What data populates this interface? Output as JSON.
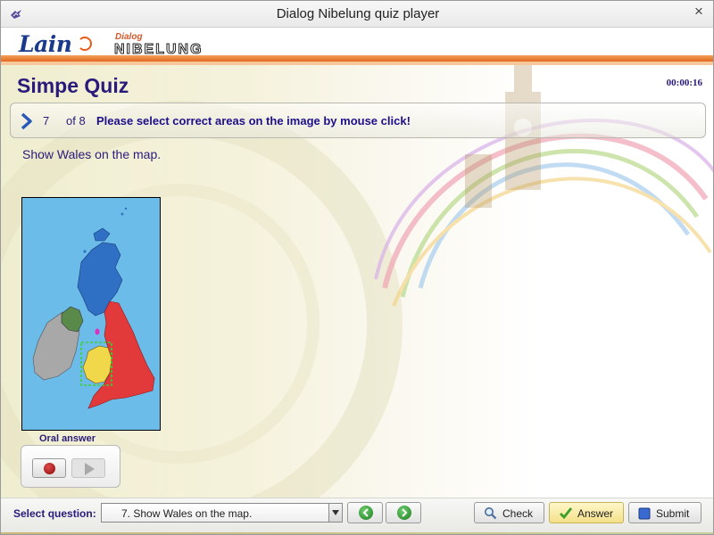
{
  "window": {
    "title": "Dialog Nibelung quiz player",
    "close_glyph": "×"
  },
  "header": {
    "logo_lain": "Lain",
    "logo_dialog": "Dialog",
    "logo_nibelung": "NIBELUNG"
  },
  "quiz": {
    "title": "Simpe Quiz",
    "timer": "00:00:16"
  },
  "question_bar": {
    "number": "7",
    "of_total": "of 8",
    "instruction": "Please select correct areas on the image by mouse click!"
  },
  "question": {
    "text": "Show Wales on the map."
  },
  "oral": {
    "label": "Oral answer"
  },
  "bottom": {
    "select_label": "Select question:",
    "select_value": "7. Show Wales on the map.",
    "check_label": "Check",
    "answer_label": "Answer",
    "submit_label": "Submit"
  },
  "icons": {
    "app": "app-icon",
    "question_arrow": "chevron-right-icon",
    "record": "record-icon",
    "play": "play-icon",
    "prev": "previous-icon",
    "next": "next-icon",
    "check": "magnifier-icon",
    "answer": "checkmark-icon",
    "submit": "submit-icon"
  },
  "colors": {
    "accent_text": "#2a1a7a",
    "orange_bar": "#e2681e",
    "map_sea": "#6cbce9",
    "scotland": "#2f6fc4",
    "england": "#e23a3a",
    "wales": "#f0d84a",
    "northern_ireland": "#5a8a4a",
    "ireland": "#a8a8a8"
  }
}
